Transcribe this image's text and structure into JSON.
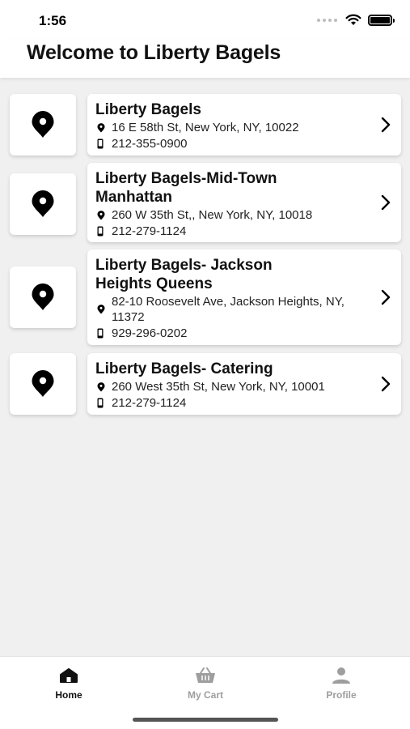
{
  "status_bar": {
    "time": "1:56"
  },
  "header": {
    "title": "Welcome to Liberty Bagels"
  },
  "locations": [
    {
      "name": "Liberty Bagels",
      "address": "16 E 58th St, New York, NY, 10022",
      "phone": "212-355-0900"
    },
    {
      "name": "Liberty Bagels-Mid-Town Manhattan",
      "address": "260 W 35th St,, New York, NY, 10018",
      "phone": "212-279-1124"
    },
    {
      "name": "Liberty Bagels- Jackson Heights Queens",
      "address": "82-10 Roosevelt Ave, Jackson Heights, NY, 11372",
      "phone": "929-296-0202"
    },
    {
      "name": "Liberty Bagels- Catering",
      "address": "260 West 35th St, New York, NY, 10001",
      "phone": "212-279-1124"
    }
  ],
  "tabs": [
    {
      "label": "Home",
      "icon": "home-icon",
      "active": true
    },
    {
      "label": "My Cart",
      "icon": "basket-icon",
      "active": false
    },
    {
      "label": "Profile",
      "icon": "person-icon",
      "active": false
    }
  ],
  "colors": {
    "active_tab": "#111111",
    "inactive_tab": "#9e9e9e",
    "background": "#f0f0f0"
  }
}
